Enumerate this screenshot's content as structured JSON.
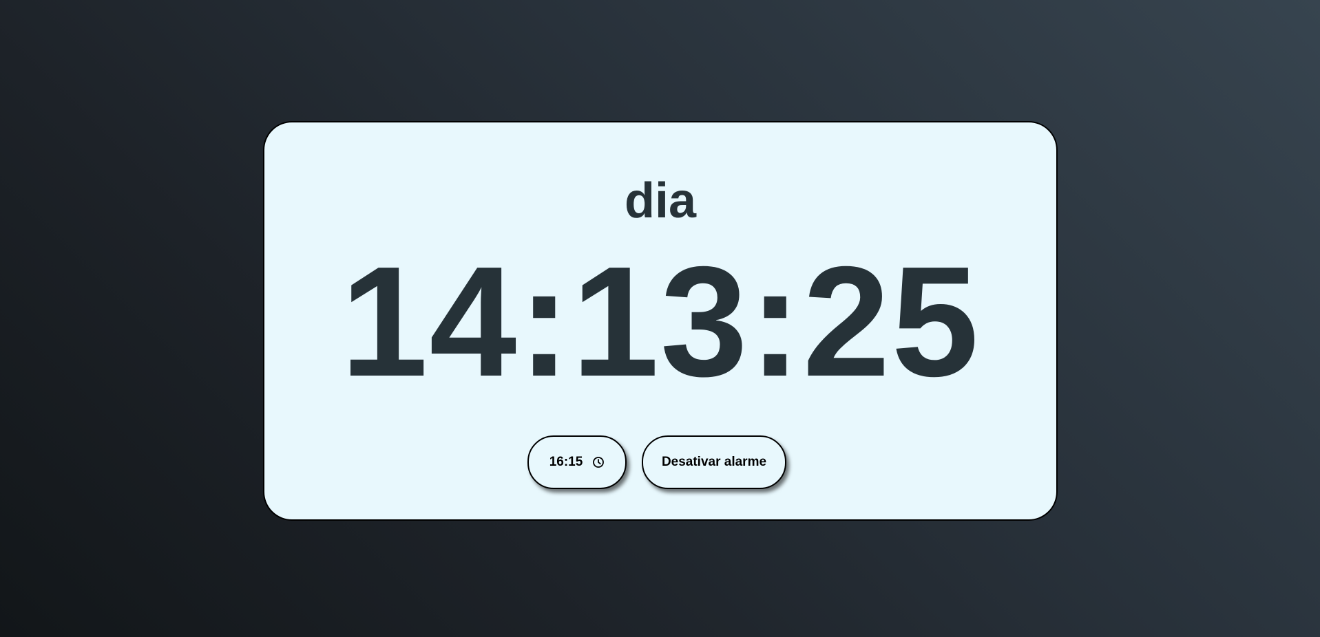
{
  "clock": {
    "period": "dia",
    "time": "14:13:25"
  },
  "alarm": {
    "time_value": "16:15",
    "time_icon": "clock-icon",
    "toggle_label": "Desativar alarme"
  },
  "colors": {
    "card_background": "#e8f8fd",
    "text": "#263238",
    "border": "#000000"
  }
}
